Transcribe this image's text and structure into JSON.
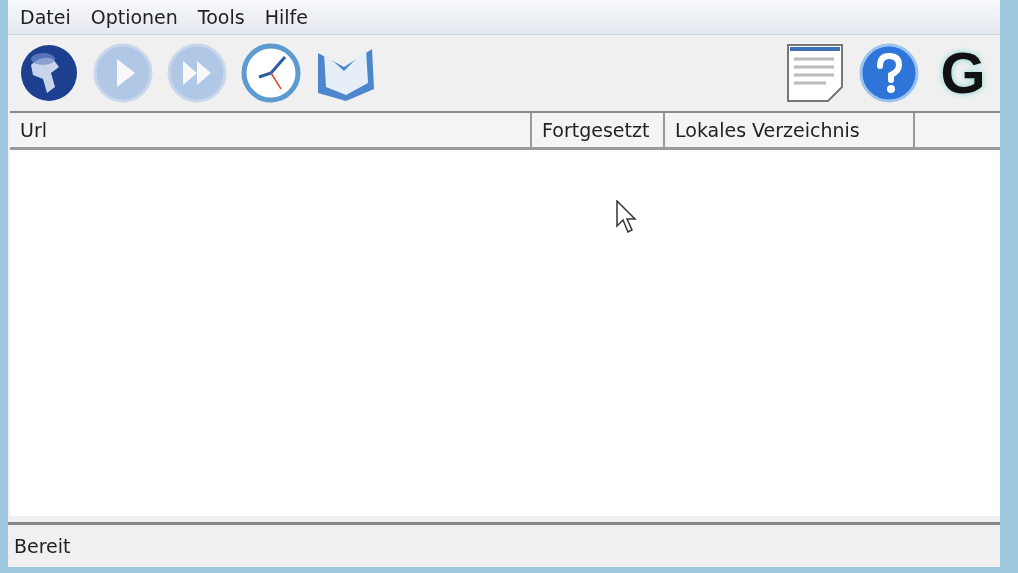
{
  "menu": [
    "Datei",
    "Optionen",
    "Tools",
    "Hilfe"
  ],
  "toolbar_left": [
    {
      "kind": "globe",
      "disabled": false
    },
    {
      "kind": "play",
      "disabled": true
    },
    {
      "kind": "forward",
      "disabled": true
    },
    {
      "kind": "clock",
      "disabled": false
    },
    {
      "kind": "book",
      "disabled": false
    }
  ],
  "toolbar_right": [
    {
      "kind": "document",
      "disabled": false
    },
    {
      "kind": "help",
      "disabled": false
    },
    {
      "kind": "letter",
      "text": "G",
      "disabled": false
    }
  ],
  "table": {
    "columns": [
      "Url",
      "Fortgesetzt",
      "Lokales Verzeichnis"
    ]
  },
  "status_bar": "Bereit"
}
